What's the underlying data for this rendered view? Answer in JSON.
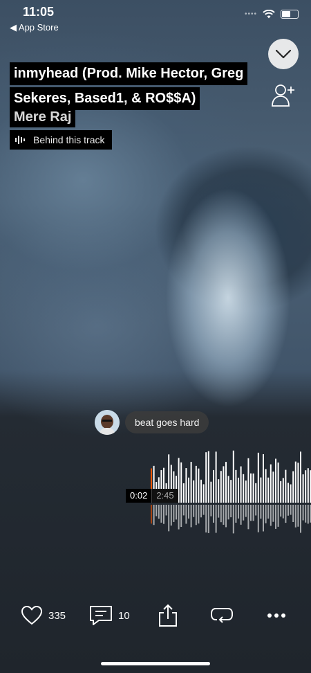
{
  "status_bar": {
    "time": "11:05",
    "back_label": "◀ App Store"
  },
  "track": {
    "title_lines": [
      "inmyhead (Prod. Mike Hector, Greg",
      "Sekeres, Based1, & RO$$A)"
    ],
    "artist": "Mere Raj",
    "behind_label": "Behind this track"
  },
  "comment": {
    "text": "beat goes hard"
  },
  "player": {
    "current_time": "0:02",
    "total_time": "2:45",
    "progress": 0.012
  },
  "actions": {
    "likes": "335",
    "comments": "10"
  },
  "icons": {
    "collapse": "chevron-down-icon",
    "follow": "add-user-icon",
    "waveform": "waveform-icon",
    "like": "heart-icon",
    "comment": "comment-icon",
    "share": "share-icon",
    "repost": "repost-icon",
    "more": "more-icon"
  },
  "colors": {
    "accent": "#ff5500",
    "bar": "#ffffff",
    "label_bg": "#000000"
  }
}
